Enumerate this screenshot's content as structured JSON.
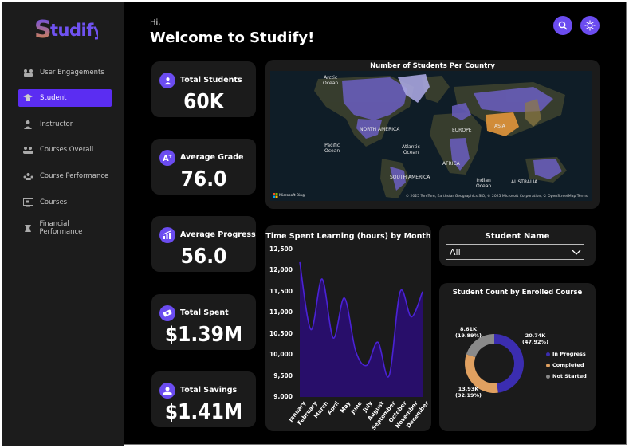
{
  "app": {
    "logo_text": "Studify",
    "greeting_hi": "Hi,",
    "greeting_title": "Welcome to Studify!",
    "accent_color": "#6b4cf0",
    "active_nav_color": "#5b2df2"
  },
  "sidebar": {
    "items": [
      {
        "label": "User Engagements",
        "icon": "users-engagement-icon"
      },
      {
        "label": "Student",
        "icon": "student-icon",
        "active": true
      },
      {
        "label": "Instructor",
        "icon": "instructor-icon"
      },
      {
        "label": "Courses Overall",
        "icon": "courses-overall-icon"
      },
      {
        "label": "Course Performance",
        "icon": "course-performance-icon"
      },
      {
        "label": "Courses",
        "icon": "courses-icon"
      },
      {
        "label": "Financial Performance",
        "icon": "financial-performance-icon"
      }
    ]
  },
  "header": {
    "search_icon": "search-icon",
    "theme_icon": "sun-icon"
  },
  "kpis": [
    {
      "label": "Total Students",
      "value": "60K",
      "icon": "student-icon"
    },
    {
      "label": "Average Grade",
      "value": "76.0",
      "icon": "grade-icon"
    },
    {
      "label": "Average Progress",
      "value": "56.0",
      "icon": "progress-chart-icon"
    },
    {
      "label": "Total Spent",
      "value": "$1.39M",
      "icon": "money-icon"
    },
    {
      "label": "Total Savings",
      "value": "$1.41M",
      "icon": "savings-icon"
    }
  ],
  "map": {
    "title": "Number of Students Per Country",
    "labels": {
      "arctic": "Arctic\nOcean",
      "north_america": "NORTH AMERICA",
      "europe": "EUROPE",
      "asia": "ASIA",
      "pacific": "Pacific\nOcean",
      "atlantic": "Atlantic\nOcean",
      "africa": "AFRICA",
      "south_america": "SOUTH AMERICA",
      "indian": "Indian\nOcean",
      "australia": "AUSTRALIA"
    },
    "brand": "Microsoft Bing",
    "attribution": "© 2025 TomTom, Earthstar Geographics SIO, © 2025 Microsoft Corporation, © OpenStreetMap   Terms"
  },
  "slicer": {
    "title": "Student Name",
    "selected": "All"
  },
  "line_chart_panel": {
    "title": "Time Spent Learning (hours) by Month"
  },
  "donut_panel": {
    "title": "Student Count by Enrolled Course",
    "labels": {
      "in_progress": "20.74K\n(47.92%)",
      "completed": "13.93K\n(32.19%)",
      "not_started": "8.61K\n(19.89%)"
    },
    "legend": [
      "In Progress",
      "Completed",
      "Not Started"
    ],
    "colors": [
      "#3b2db0",
      "#e0a060",
      "#8a8a8a"
    ]
  },
  "chart_data": [
    {
      "type": "area",
      "title": "Time Spent Learning (hours) by Month",
      "categories": [
        "January",
        "February",
        "March",
        "April",
        "May",
        "June",
        "July",
        "August",
        "September",
        "October",
        "November",
        "December"
      ],
      "values": [
        12200,
        10600,
        11800,
        10400,
        11350,
        10100,
        9750,
        10300,
        9500,
        11500,
        10900,
        11500
      ],
      "ylim": [
        9000,
        12500
      ],
      "yticks": [
        "12,500",
        "12,000",
        "11,500",
        "11,000",
        "10,500",
        "10,000",
        "9,500",
        "9,000"
      ],
      "color": "#4a22d6"
    },
    {
      "type": "pie",
      "title": "Student Count by Enrolled Course",
      "categories": [
        "In Progress",
        "Completed",
        "Not Started"
      ],
      "values": [
        20740,
        13930,
        8610
      ],
      "percentages": [
        47.92,
        32.19,
        19.89
      ]
    }
  ]
}
